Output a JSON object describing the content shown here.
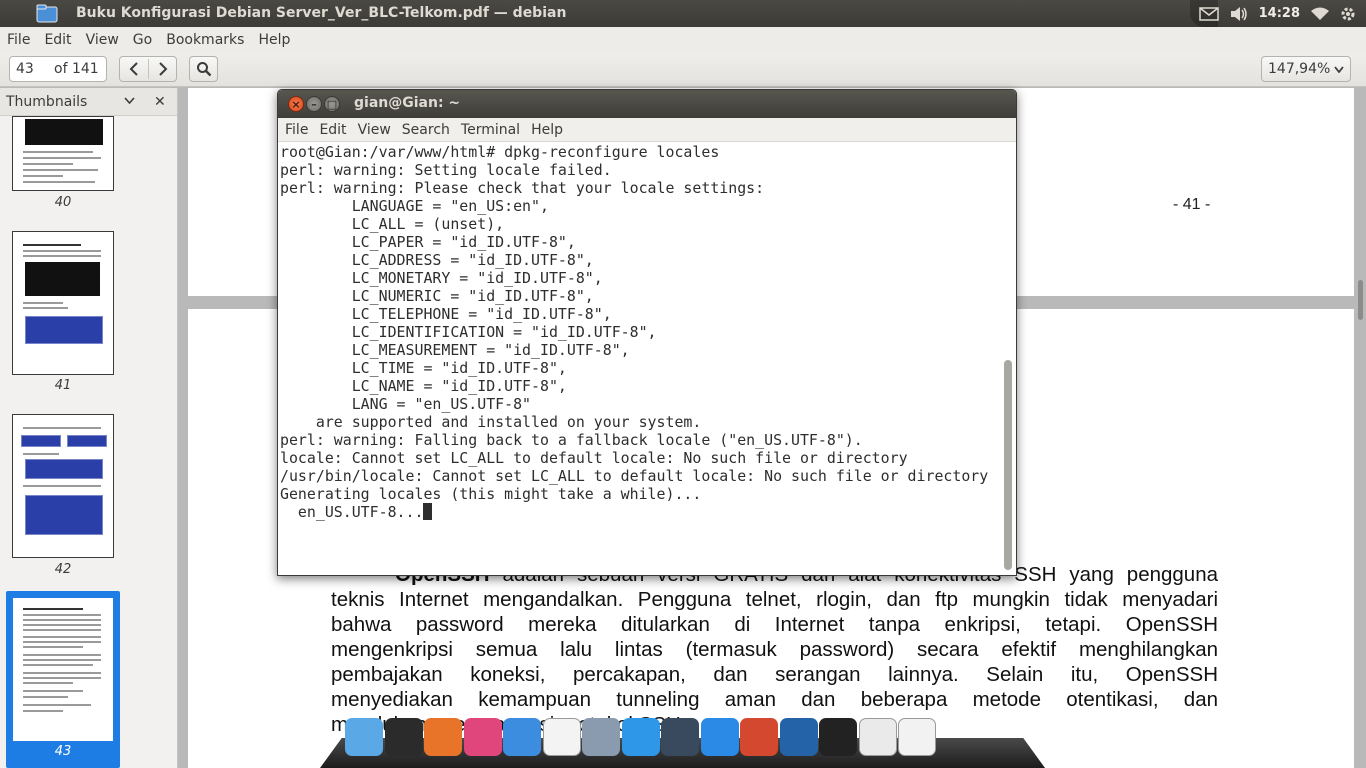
{
  "top_panel": {
    "window_title": "Buku Konfigurasi Debian Server_Ver_BLC-Telkom.pdf — debian",
    "clock": "14:28"
  },
  "menubar": [
    "File",
    "Edit",
    "View",
    "Go",
    "Bookmarks",
    "Help"
  ],
  "toolbar": {
    "page_current": "43",
    "page_of": "of 141",
    "zoom": "147,94%"
  },
  "sidebar": {
    "title": "Thumbnails",
    "thumbnails": [
      {
        "label": "40"
      },
      {
        "label": "41"
      },
      {
        "label": "42"
      },
      {
        "label": "43",
        "selected": true
      }
    ]
  },
  "document": {
    "page41_number": "- 41 -",
    "paragraph_lines": [
      {
        "bold": "OpenSSH",
        "text": " adalah sebuah versi GRATIS dari alat konektivitas SSH yang pengguna"
      },
      {
        "bold": "",
        "text": "teknis Internet mengandalkan. Pengguna telnet, rlogin, dan ftp mungkin tidak menyadari"
      },
      {
        "bold": "",
        "text": "bahwa password mereka ditularkan di Internet tanpa enkripsi, tetapi. OpenSSH"
      },
      {
        "bold": "",
        "text": "mengenkripsi semua lalu lintas (termasuk password) secara efektif menghilangkan"
      },
      {
        "bold": "",
        "text": "pembajakan koneksi, percakapan, dan serangan lainnya. Selain itu, OpenSSH"
      },
      {
        "bold": "",
        "text": "menyediakan kemampuan tunneling aman dan beberapa metode otentikasi, dan"
      },
      {
        "bold": "",
        "text": "mendukung semua versi protokol SSH."
      }
    ]
  },
  "terminal": {
    "title": "gian@Gian: ~",
    "menu": [
      "File",
      "Edit",
      "View",
      "Search",
      "Terminal",
      "Help"
    ],
    "lines": [
      "root@Gian:/var/www/html# dpkg-reconfigure locales",
      "perl: warning: Setting locale failed.",
      "perl: warning: Please check that your locale settings:",
      "        LANGUAGE = \"en_US:en\",",
      "        LC_ALL = (unset),",
      "        LC_PAPER = \"id_ID.UTF-8\",",
      "        LC_ADDRESS = \"id_ID.UTF-8\",",
      "        LC_MONETARY = \"id_ID.UTF-8\",",
      "        LC_NUMERIC = \"id_ID.UTF-8\",",
      "        LC_TELEPHONE = \"id_ID.UTF-8\",",
      "        LC_IDENTIFICATION = \"id_ID.UTF-8\",",
      "        LC_MEASUREMENT = \"id_ID.UTF-8\",",
      "        LC_TIME = \"id_ID.UTF-8\",",
      "        LC_NAME = \"id_ID.UTF-8\",",
      "        LANG = \"en_US.UTF-8\"",
      "    are supported and installed on your system.",
      "perl: warning: Falling back to a fallback locale (\"en_US.UTF-8\").",
      "locale: Cannot set LC_ALL to default locale: No such file or directory",
      "/usr/bin/locale: Cannot set LC_ALL to default locale: No such file or directory",
      "Generating locales (this might take a while)...",
      "  en_US.UTF-8..."
    ]
  },
  "dock": {
    "icons": [
      {
        "name": "files-icon",
        "color": "#5aa9e6"
      },
      {
        "name": "terminal-icon",
        "color": "#2b2b2b"
      },
      {
        "name": "firefox-icon",
        "color": "#e8742a"
      },
      {
        "name": "music-icon",
        "color": "#e0457b"
      },
      {
        "name": "finder-icon",
        "color": "#3c8de0"
      },
      {
        "name": "document-viewer-icon",
        "color": "#f3f3f3"
      },
      {
        "name": "image-viewer-icon",
        "color": "#8a9bb0"
      },
      {
        "name": "chat-icon",
        "color": "#2f97e8"
      },
      {
        "name": "dashboard-icon",
        "color": "#394a5e"
      },
      {
        "name": "app-store-icon",
        "color": "#2a8ae6"
      },
      {
        "name": "network-icon",
        "color": "#d3482e"
      },
      {
        "name": "thunderbird-icon",
        "color": "#2563a8"
      },
      {
        "name": "active-terminal-icon",
        "color": "#222222"
      },
      {
        "name": "text-editor-icon",
        "color": "#eaeaea"
      },
      {
        "name": "clock-icon",
        "color": "#f2f2f2"
      }
    ]
  }
}
